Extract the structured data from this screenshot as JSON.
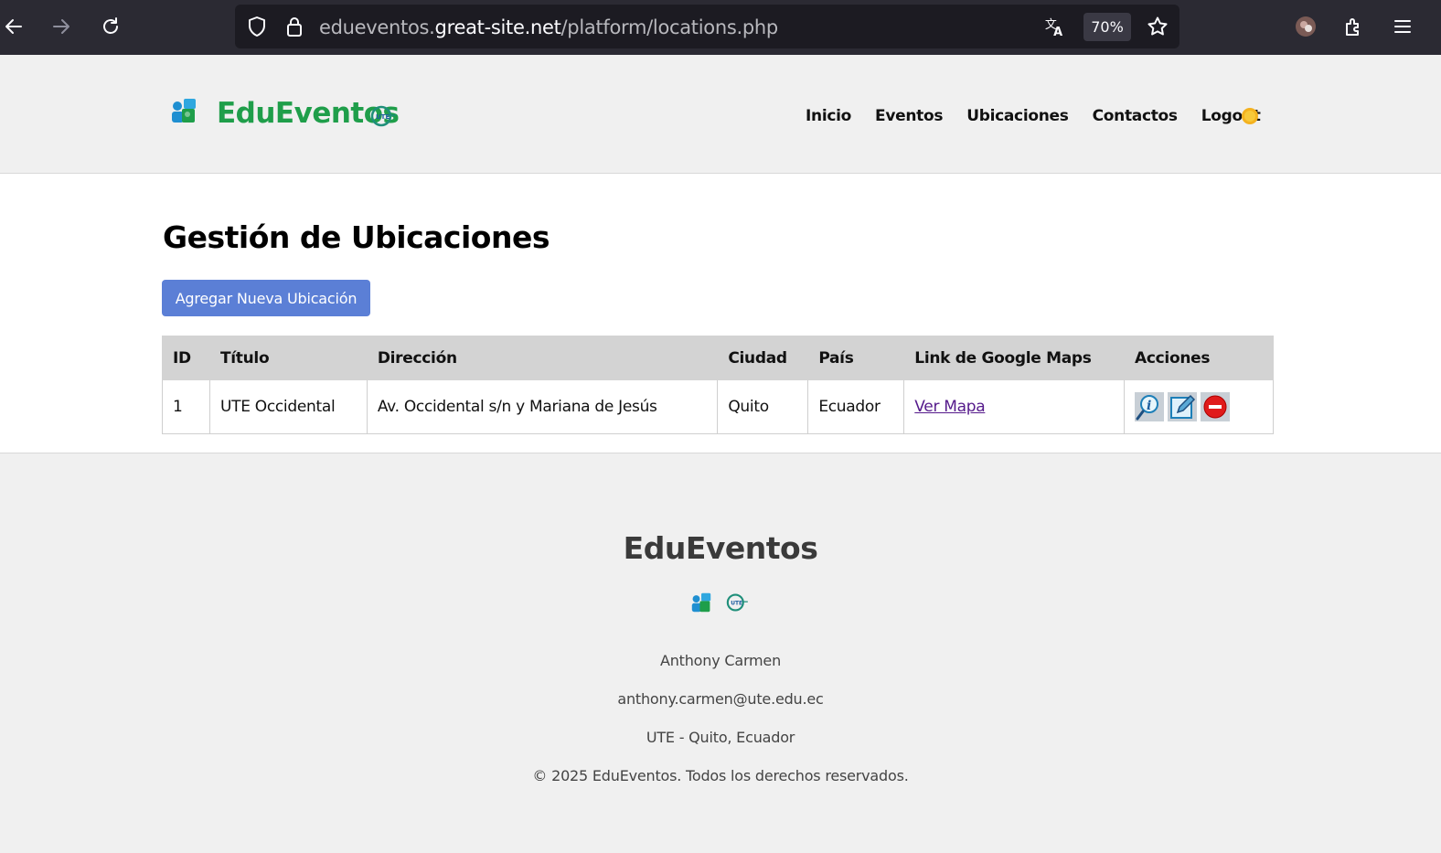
{
  "browser": {
    "url_prefix": "edueventos.",
    "url_host": "great-site.net",
    "url_path": "/platform/locations.php",
    "zoom": "70%"
  },
  "header": {
    "brand": "EduEventos",
    "nav": [
      "Inicio",
      "Eventos",
      "Ubicaciones",
      "Contactos",
      "Logout"
    ]
  },
  "main": {
    "title": "Gestión de Ubicaciones",
    "add_button": "Agregar Nueva Ubicación",
    "columns": [
      "ID",
      "Título",
      "Dirección",
      "Ciudad",
      "País",
      "Link de Google Maps",
      "Acciones"
    ],
    "rows": [
      {
        "id": "1",
        "titulo": "UTE Occidental",
        "direccion": "Av. Occidental s/n y Mariana de Jesús",
        "ciudad": "Quito",
        "pais": "Ecuador",
        "link": "Ver Mapa"
      }
    ]
  },
  "footer": {
    "title": "EduEventos",
    "author": "Anthony Carmen",
    "email": "anthony.carmen@ute.edu.ec",
    "location": "UTE - Quito, Ecuador",
    "copyright": "© 2025 EduEventos. Todos los derechos reservados."
  },
  "colors": {
    "brand_green": "#1f9e4a",
    "button_blue": "#5b7fd6",
    "header_bg": "#f0f0f0",
    "table_header_bg": "#d3d3d3"
  }
}
